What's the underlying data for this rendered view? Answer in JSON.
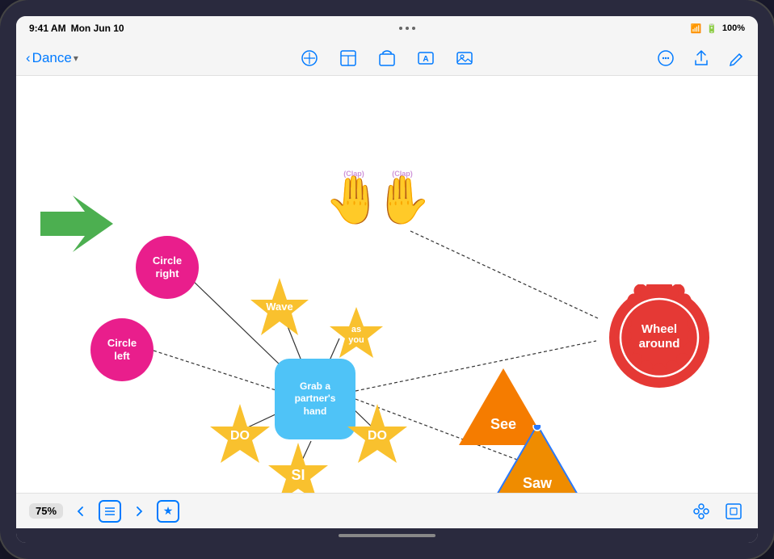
{
  "status_bar": {
    "time": "9:41 AM",
    "date": "Mon Jun 10",
    "battery": "100%",
    "dots": [
      "•",
      "•",
      "•"
    ]
  },
  "toolbar": {
    "back_label": "Dance",
    "back_arrow": "‹",
    "chevron": "∨",
    "icons": {
      "shapes": "⬡",
      "table": "⊞",
      "media": "⬒",
      "text": "A",
      "image": "⬜"
    },
    "right_icons": {
      "more": "⊙",
      "share": "↑",
      "edit": "✎"
    }
  },
  "shapes": {
    "circle_right": {
      "label": "Circle\nright",
      "color": "#E91E8C",
      "text_color": "#fff"
    },
    "circle_left": {
      "label": "Circle\nleft",
      "color": "#E91E8C",
      "text_color": "#fff"
    },
    "center_box": {
      "label": "Grab a\npartner's\nhand",
      "color": "#4FC3F7",
      "text_color": "#fff"
    },
    "wave": {
      "label": "Wave",
      "color": "#F9C12E"
    },
    "as_you": {
      "label": "as\nyou",
      "color": "#F9C12E"
    },
    "do_left": {
      "label": "DO",
      "color": "#F9C12E"
    },
    "si": {
      "label": "SI",
      "color": "#F9C12E"
    },
    "do_right": {
      "label": "DO",
      "color": "#F9C12E"
    },
    "wheel_around": {
      "label": "Wheel\naround",
      "color": "#E53935",
      "text_color": "#fff"
    },
    "clap_left": {
      "label": "(Clap)",
      "color": "#7B1FA2"
    },
    "clap_right": {
      "label": "(Clap)",
      "color": "#7B1FA2"
    },
    "see": {
      "label": "See",
      "color": "#F57C00",
      "text_color": "#fff"
    },
    "saw": {
      "label": "Saw",
      "color": "#EF8C00",
      "text_color": "#fff"
    }
  },
  "bottom_bar": {
    "zoom": "75%",
    "nav_back": "‹",
    "nav_list": "≡",
    "nav_forward": "›",
    "star_icon": "★"
  }
}
